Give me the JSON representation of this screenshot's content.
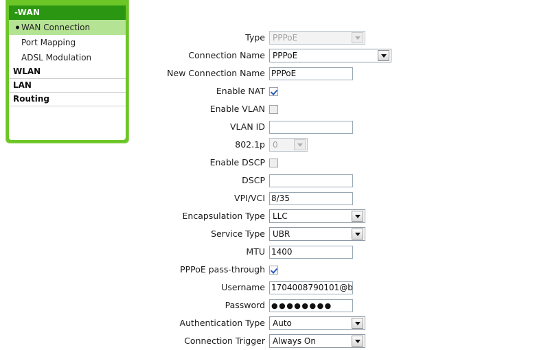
{
  "sidebar": {
    "group": {
      "label": "-WAN",
      "items": [
        {
          "label": "WAN Connection",
          "active": true,
          "bullet": "bullet-icon"
        },
        {
          "label": "Port Mapping",
          "active": false
        },
        {
          "label": "ADSL Modulation",
          "active": false
        }
      ]
    },
    "headers": [
      {
        "label": "WLAN"
      },
      {
        "label": "LAN"
      },
      {
        "label": "Routing"
      }
    ],
    "colors": {
      "panel_green": "#6cc627",
      "group_header_green": "#2b9611",
      "active_row_green": "#b5e394"
    }
  },
  "form": {
    "rows": [
      {
        "label": "Type",
        "kind": "select",
        "value": "PPPoE",
        "disabled": true,
        "width": "normal"
      },
      {
        "label": "Connection Name",
        "kind": "select",
        "value": "PPPoE",
        "disabled": false,
        "width": "wide"
      },
      {
        "label": "New Connection Name",
        "kind": "text",
        "value": "PPPoE"
      },
      {
        "label": "Enable NAT",
        "kind": "checkbox",
        "checked": true
      },
      {
        "label": "Enable VLAN",
        "kind": "checkbox",
        "checked": false
      },
      {
        "label": "VLAN ID",
        "kind": "text",
        "value": ""
      },
      {
        "label": "802.1p",
        "kind": "select",
        "value": "0",
        "disabled": true,
        "width": "narrow"
      },
      {
        "label": "Enable DSCP",
        "kind": "checkbox",
        "checked": false
      },
      {
        "label": "DSCP",
        "kind": "text",
        "value": ""
      },
      {
        "label": "VPI/VCI",
        "kind": "text",
        "value": "8/35"
      },
      {
        "label": "Encapsulation Type",
        "kind": "select",
        "value": "LLC",
        "disabled": false,
        "width": "normal"
      },
      {
        "label": "Service Type",
        "kind": "select",
        "value": "UBR",
        "disabled": false,
        "width": "normal"
      },
      {
        "label": "MTU",
        "kind": "text",
        "value": "1400"
      },
      {
        "label": "PPPoE pass-through",
        "kind": "checkbox",
        "checked": true
      },
      {
        "label": "Username",
        "kind": "text",
        "value": "1704008790101@b"
      },
      {
        "label": "Password",
        "kind": "password",
        "value": "●●●●●●●●"
      },
      {
        "label": "Authentication Type",
        "kind": "select",
        "value": "Auto",
        "disabled": false,
        "width": "normal"
      },
      {
        "label": "Connection Trigger",
        "kind": "select",
        "value": "Always On",
        "disabled": false,
        "width": "normal"
      }
    ]
  }
}
